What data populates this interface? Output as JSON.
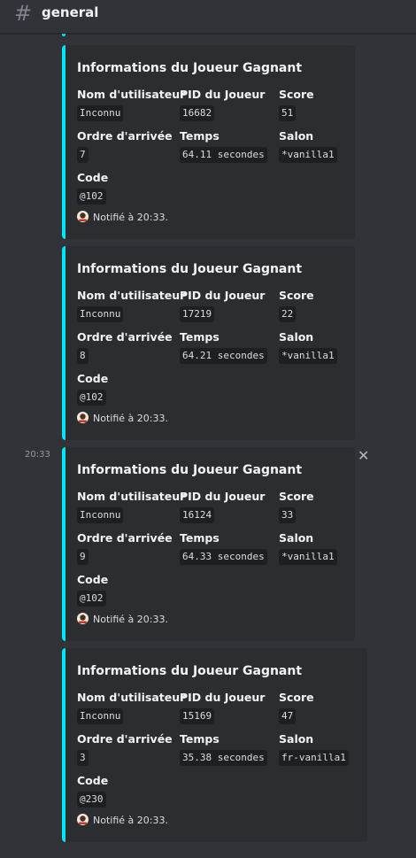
{
  "channel": {
    "name": "general"
  },
  "message": {
    "timestamp": "20:33"
  },
  "colors": {
    "accent": "#00e5f5",
    "background": "#313338",
    "embed": "#2b2d31"
  },
  "embeds": [
    {
      "title": "Informations du Joueur Gagnant",
      "fields": [
        {
          "name": "Nom d'utilisateur",
          "value": "Inconnu"
        },
        {
          "name": "PID du Joueur",
          "value": "16682"
        },
        {
          "name": "Score",
          "value": "51"
        },
        {
          "name": "Ordre d'arrivée",
          "value": "7"
        },
        {
          "name": "Temps",
          "value": "64.11 secondes"
        },
        {
          "name": "Salon",
          "value": "*vanilla1"
        },
        {
          "name": "Code",
          "value": "@102"
        }
      ],
      "footer": "Notifié à 20:33."
    },
    {
      "title": "Informations du Joueur Gagnant",
      "fields": [
        {
          "name": "Nom d'utilisateur",
          "value": "Inconnu"
        },
        {
          "name": "PID du Joueur",
          "value": "17219"
        },
        {
          "name": "Score",
          "value": "22"
        },
        {
          "name": "Ordre d'arrivée",
          "value": "8"
        },
        {
          "name": "Temps",
          "value": "64.21 secondes"
        },
        {
          "name": "Salon",
          "value": "*vanilla1"
        },
        {
          "name": "Code",
          "value": "@102"
        }
      ],
      "footer": "Notifié à 20:33."
    },
    {
      "title": "Informations du Joueur Gagnant",
      "fields": [
        {
          "name": "Nom d'utilisateur",
          "value": "Inconnu"
        },
        {
          "name": "PID du Joueur",
          "value": "16124"
        },
        {
          "name": "Score",
          "value": "33"
        },
        {
          "name": "Ordre d'arrivée",
          "value": "9"
        },
        {
          "name": "Temps",
          "value": "64.33 secondes"
        },
        {
          "name": "Salon",
          "value": "*vanilla1"
        },
        {
          "name": "Code",
          "value": "@102"
        }
      ],
      "footer": "Notifié à 20:33."
    },
    {
      "title": "Informations du Joueur Gagnant",
      "fields": [
        {
          "name": "Nom d'utilisateur",
          "value": "Inconnu"
        },
        {
          "name": "PID du Joueur",
          "value": "15169"
        },
        {
          "name": "Score",
          "value": "47"
        },
        {
          "name": "Ordre d'arrivée",
          "value": "3"
        },
        {
          "name": "Temps",
          "value": "35.38 secondes"
        },
        {
          "name": "Salon",
          "value": "fr-vanilla1"
        },
        {
          "name": "Code",
          "value": "@230"
        }
      ],
      "footer": "Notifié à 20:33."
    }
  ]
}
